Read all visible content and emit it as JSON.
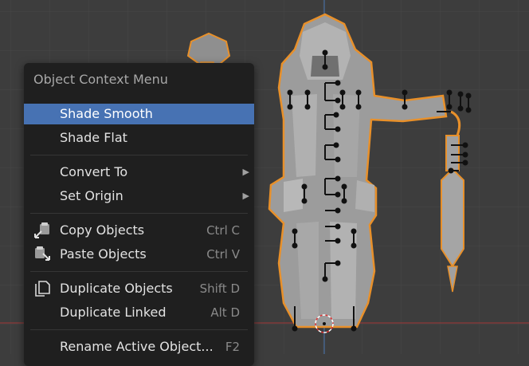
{
  "menu": {
    "title": "Object Context Menu",
    "items": [
      {
        "label": "Shade Smooth",
        "shortcut": "",
        "icon": "",
        "active": true
      },
      {
        "label": "Shade Flat",
        "shortcut": "",
        "icon": ""
      },
      {
        "label": "Convert To",
        "shortcut": "",
        "icon": "",
        "submenu": true
      },
      {
        "label": "Set Origin",
        "shortcut": "",
        "icon": "",
        "submenu": true
      },
      {
        "label": "Copy Objects",
        "shortcut": "Ctrl C",
        "icon": "copy-icon"
      },
      {
        "label": "Paste Objects",
        "shortcut": "Ctrl V",
        "icon": "paste-icon"
      },
      {
        "label": "Duplicate Objects",
        "shortcut": "Shift D",
        "icon": "duplicate-icon"
      },
      {
        "label": "Duplicate Linked",
        "shortcut": "Alt D",
        "icon": ""
      },
      {
        "label": "Rename Active Object...",
        "shortcut": "F2",
        "icon": ""
      }
    ],
    "submenu_glyph": "▶"
  },
  "colors": {
    "viewport_bg": "#3d3d3d",
    "menu_bg": "#1f1f1f",
    "highlight": "#4772b3",
    "selection_outline": "#e8902a",
    "model": "#9c9c9c"
  }
}
